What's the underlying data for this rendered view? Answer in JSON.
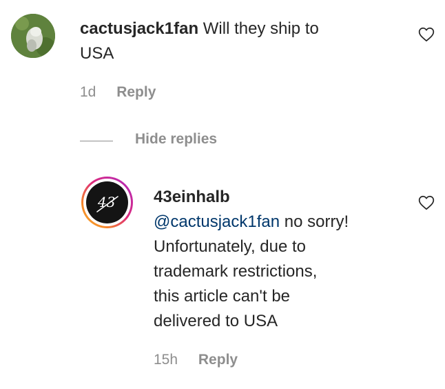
{
  "comment": {
    "username": "cactusjack1fan",
    "text_line1": "Will they ship to",
    "text_line2": "USA",
    "time": "1d",
    "reply_label": "Reply"
  },
  "hide_replies_label": "Hide replies",
  "reply": {
    "username": "43einhalb",
    "mention": "@cactusjack1fan",
    "text_line1_rest": " no sorry!",
    "text_line2": "Unfortunately, due to",
    "text_line3": "trademark restrictions,",
    "text_line4": "this article can't be",
    "text_line5": "delivered to USA",
    "time": "15h",
    "reply_label": "Reply",
    "avatar_text": "43"
  },
  "icons": {
    "like": "heart-outline-icon"
  }
}
